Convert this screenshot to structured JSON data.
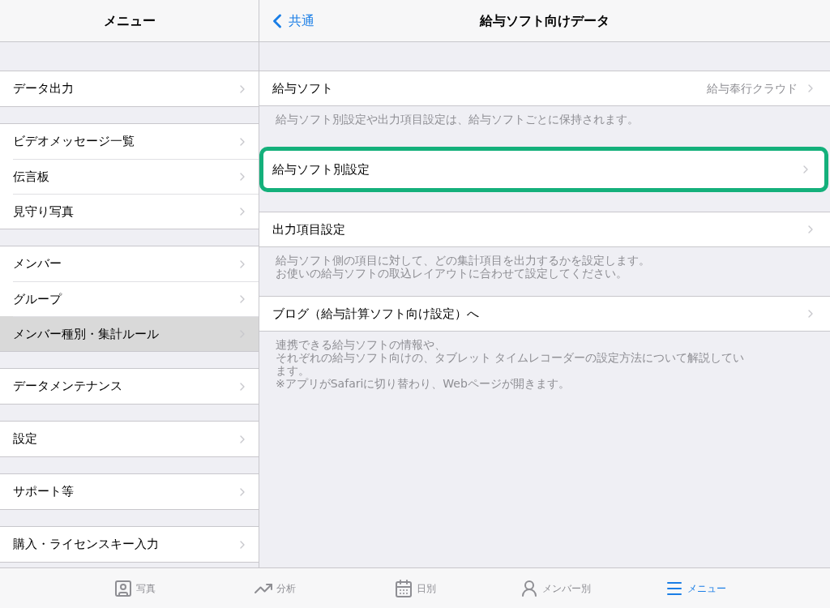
{
  "sidebar": {
    "title": "メニュー",
    "groups": [
      {
        "items": [
          {
            "label": "データ出力",
            "selected": false
          }
        ]
      },
      {
        "items": [
          {
            "label": "ビデオメッセージ一覧",
            "selected": false
          },
          {
            "label": "伝言板",
            "selected": false
          },
          {
            "label": "見守り写真",
            "selected": false
          }
        ]
      },
      {
        "items": [
          {
            "label": "メンバー",
            "selected": false
          },
          {
            "label": "グループ",
            "selected": false
          },
          {
            "label": "メンバー種別・集計ルール",
            "selected": true
          }
        ]
      },
      {
        "items": [
          {
            "label": "データメンテナンス",
            "selected": false
          }
        ]
      },
      {
        "items": [
          {
            "label": "設定",
            "selected": false
          }
        ]
      },
      {
        "items": [
          {
            "label": "サポート等",
            "selected": false
          }
        ]
      },
      {
        "items": [
          {
            "label": "購入・ライセンスキー入力",
            "selected": false
          }
        ]
      }
    ]
  },
  "detail": {
    "back": "共通",
    "title": "給与ソフト向けデータ",
    "sections": [
      {
        "rows": [
          {
            "label": "給与ソフト",
            "value": "給与奉行クラウド",
            "highlighted": false
          }
        ],
        "footer": [
          "給与ソフト別設定や出力項目設定は、給与ソフトごとに保持されます。"
        ]
      },
      {
        "rows": [
          {
            "label": "給与ソフト別設定",
            "highlighted": true
          }
        ]
      },
      {
        "rows": [
          {
            "label": "出力項目設定",
            "highlighted": false
          }
        ],
        "footer": [
          "給与ソフト側の項目に対して、どの集計項目を出力するかを設定します。",
          "お使いの給与ソフトの取込レイアウトに合わせて設定してください。"
        ]
      },
      {
        "rows": [
          {
            "label": "ブログ（給与計算ソフト向け設定）へ",
            "highlighted": false
          }
        ],
        "footer": [
          "連携できる給与ソフトの情報や、",
          "それぞれの給与ソフト向けの、タブレット タイムレコーダーの設定方法について解説してい",
          "ます。",
          "※アプリがSafariに切り替わり、Webページが開きます。"
        ]
      }
    ]
  },
  "tab_bar": [
    {
      "kind": "photo",
      "label": "写真",
      "selected": false
    },
    {
      "kind": "chart",
      "label": "分析",
      "selected": false
    },
    {
      "kind": "calendar",
      "label": "日別",
      "selected": false
    },
    {
      "kind": "member",
      "label": "メンバー別",
      "selected": false
    },
    {
      "kind": "menu",
      "label": "メニュー",
      "selected": true
    }
  ]
}
